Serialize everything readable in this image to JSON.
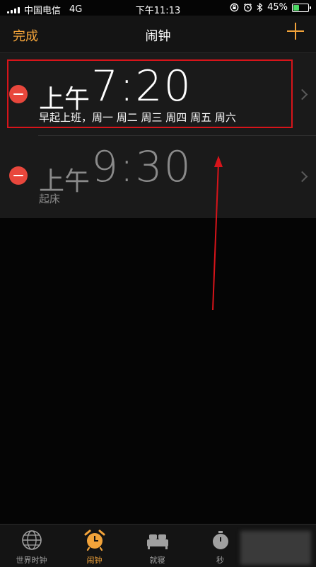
{
  "status_bar": {
    "carrier": "中国电信",
    "network": "4G",
    "time": "下午11:13",
    "battery": "45%",
    "battery_level": 0.45,
    "icons": [
      "signal-icon",
      "orientation-lock-icon",
      "alarm-icon",
      "bluetooth-icon",
      "battery-icon"
    ]
  },
  "nav": {
    "done_label": "完成",
    "title": "闹钟",
    "add_icon": "plus-icon"
  },
  "alarms": [
    {
      "ampm": "上午",
      "time": "7:20",
      "label": "早起上班，周一 周二 周三 周四 周五 周六",
      "enabled": true
    },
    {
      "ampm": "上午",
      "time": "9:30",
      "label": "起床",
      "enabled": false
    }
  ],
  "tabs": [
    {
      "label": "世界时钟",
      "icon": "globe-icon",
      "active": false
    },
    {
      "label": "闹钟",
      "icon": "alarm-clock-icon",
      "active": true
    },
    {
      "label": "就寝",
      "icon": "bed-icon",
      "active": false
    },
    {
      "label": "秒",
      "icon": "stopwatch-icon",
      "active": false
    }
  ],
  "colors": {
    "accent": "#f2a33a",
    "delete": "#e8473c",
    "highlight": "#d7141a",
    "background": "#050505"
  }
}
